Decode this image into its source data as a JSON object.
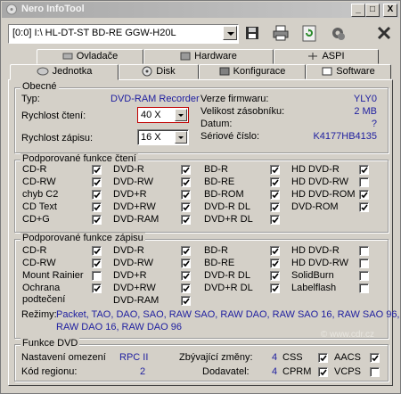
{
  "window": {
    "title": "Nero InfoTool",
    "buttons": [
      "_",
      "□",
      "X"
    ]
  },
  "toolbar": {
    "drive": "[0:0]  I:\\ HL-DT-ST BD-RE  GGW-H20L"
  },
  "tabs_top": [
    {
      "label": "Ovladače",
      "icon": "driver-icon"
    },
    {
      "label": "Hardware",
      "icon": "hardware-icon"
    },
    {
      "label": "ASPI",
      "icon": "aspi-icon"
    }
  ],
  "tabs_bottom": [
    {
      "label": "Jednotka",
      "icon": "drive-icon"
    },
    {
      "label": "Disk",
      "icon": "disc-icon"
    },
    {
      "label": "Konfigurace",
      "icon": "config-icon"
    },
    {
      "label": "Software",
      "icon": "software-icon"
    }
  ],
  "general": {
    "title": "Obecné",
    "type_label": "Typ:",
    "type_value": "DVD-RAM Recorder",
    "read_label": "Rychlost čtení:",
    "read_value": "40 X",
    "write_label": "Rychlost zápisu:",
    "write_value": "16 X",
    "fw_label": "Verze firmwaru:",
    "fw_value": "YLY0",
    "buf_label": "Velikost zásobníku:",
    "buf_value": "2 MB",
    "date_label": "Datum:",
    "date_value": "?",
    "serial_label": "Sériové číslo:",
    "serial_value": "K4177HB4135"
  },
  "read_functions": {
    "title": "Podporované funkce čtení",
    "columns": [
      [
        {
          "label": "CD-R",
          "checked": true
        },
        {
          "label": "CD-RW",
          "checked": true
        },
        {
          "label": "chyb C2",
          "checked": true
        },
        {
          "label": "CD Text",
          "checked": true
        },
        {
          "label": "CD+G",
          "checked": true
        }
      ],
      [
        {
          "label": "DVD-R",
          "checked": true
        },
        {
          "label": "DVD-RW",
          "checked": true
        },
        {
          "label": "DVD+R",
          "checked": true
        },
        {
          "label": "DVD+RW",
          "checked": true
        },
        {
          "label": "DVD-RAM",
          "checked": true
        }
      ],
      [
        {
          "label": "BD-R",
          "checked": true
        },
        {
          "label": "BD-RE",
          "checked": true
        },
        {
          "label": "BD-ROM",
          "checked": true
        },
        {
          "label": "DVD-R DL",
          "checked": true
        },
        {
          "label": "DVD+R DL",
          "checked": true
        }
      ],
      [
        {
          "label": "HD DVD-R",
          "checked": true
        },
        {
          "label": "HD DVD-RW",
          "checked": false
        },
        {
          "label": "HD DVD-ROM",
          "checked": true
        },
        {
          "label": "DVD-ROM",
          "checked": true
        }
      ]
    ]
  },
  "write_functions": {
    "title": "Podporované funkce zápisu",
    "columns": [
      [
        {
          "label": "CD-R",
          "checked": true
        },
        {
          "label": "CD-RW",
          "checked": true
        },
        {
          "label": "Mount Rainier",
          "checked": false
        },
        {
          "label": "Ochrana",
          "label2": "podtečení",
          "checked": true
        }
      ],
      [
        {
          "label": "DVD-R",
          "checked": true
        },
        {
          "label": "DVD-RW",
          "checked": true
        },
        {
          "label": "DVD+R",
          "checked": true
        },
        {
          "label": "DVD+RW",
          "checked": true
        },
        {
          "label": "DVD-RAM",
          "checked": true
        }
      ],
      [
        {
          "label": "BD-R",
          "checked": true
        },
        {
          "label": "BD-RE",
          "checked": true
        },
        {
          "label": "DVD-R DL",
          "checked": true
        },
        {
          "label": "DVD+R DL",
          "checked": true
        }
      ],
      [
        {
          "label": "HD DVD-R",
          "checked": false
        },
        {
          "label": "HD DVD-RW",
          "checked": false
        },
        {
          "label": "SolidBurn",
          "checked": false
        },
        {
          "label": "Labelflash",
          "checked": false
        }
      ]
    ],
    "modes_label": "Režimy:",
    "modes_line1": "Packet, TAO, DAO, SAO, RAW SAO, RAW DAO, RAW SAO 16, RAW SAO 96,",
    "modes_line2": "RAW DAO 16, RAW DAO 96"
  },
  "dvd": {
    "title": "Funkce DVD",
    "region_set_label": "Nastavení omezení",
    "region_set_value": "RPC II",
    "region_code_label": "Kód regionu:",
    "region_code_value": "2",
    "changes_label": "Zbývající změny:",
    "changes_value": "4",
    "vendor_label": "Dodavatel:",
    "vendor_value": "4",
    "flags": [
      {
        "label": "CSS",
        "checked": true
      },
      {
        "label": "AACS",
        "checked": true
      },
      {
        "label": "CPRM",
        "checked": true
      },
      {
        "label": "VCPS",
        "checked": false
      }
    ]
  },
  "watermark": "© www.cdr.cz"
}
